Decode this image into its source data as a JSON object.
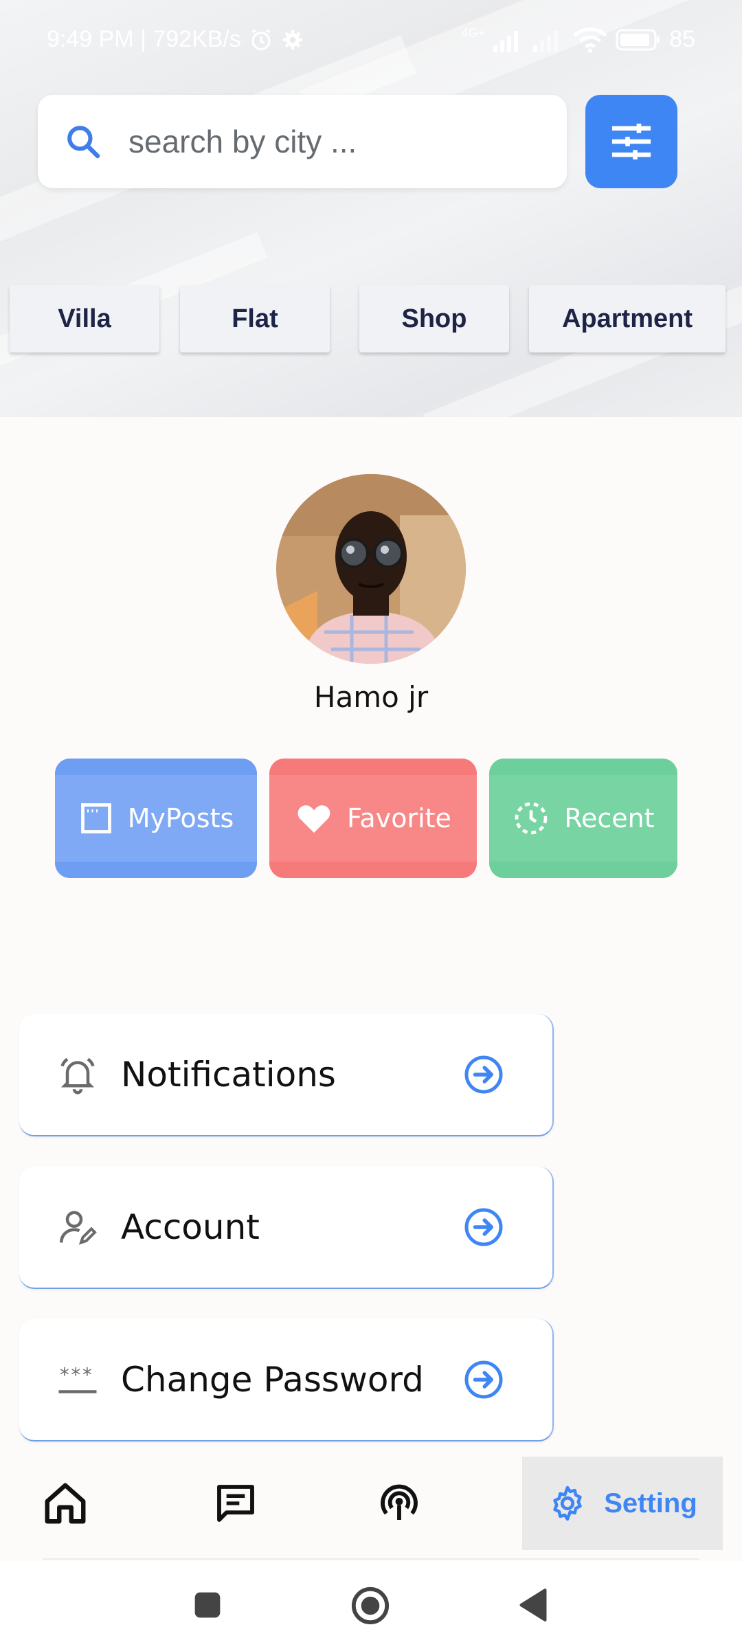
{
  "status_bar": {
    "time_speed": "9:49 PM | 792KB/s",
    "network_label": "4G+",
    "battery": "85"
  },
  "search": {
    "placeholder": "search by city ...",
    "icon": "search-icon"
  },
  "filter": {
    "icon": "tune-sliders-icon"
  },
  "categories": [
    "Villa",
    "Flat",
    "Shop",
    "Apartment"
  ],
  "profile": {
    "name": "Hamo jr",
    "avatar": "user-photo"
  },
  "quick_actions": [
    {
      "label": "MyPosts",
      "icon": "window-icon",
      "color": "#6e9ef2"
    },
    {
      "label": "Favorite",
      "icon": "heart-icon",
      "color": "#f77a7a"
    },
    {
      "label": "Recent",
      "icon": "clock-icon",
      "color": "#6dcf9b"
    }
  ],
  "menu": [
    {
      "label": "Notifications",
      "icon": "bell-icon"
    },
    {
      "label": "Account",
      "icon": "user-edit-icon"
    },
    {
      "label": "Change Password",
      "icon": "password-icon"
    }
  ],
  "bottom_nav": {
    "items": [
      "home-icon",
      "chat-icon",
      "broadcast-icon"
    ],
    "active_label": "Setting",
    "active_icon": "settings-icon",
    "accent": "#3f86f5"
  },
  "system_nav": [
    "recents-square-icon",
    "home-circle-icon",
    "back-triangle-icon"
  ]
}
